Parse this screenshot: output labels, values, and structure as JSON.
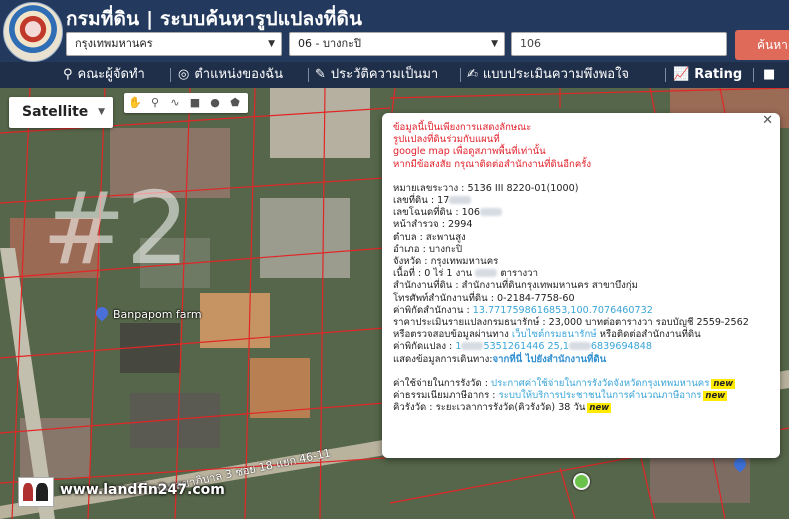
{
  "header": {
    "title": "กรมที่ดิน | ระบบค้นหารูปแปลงที่ดิน",
    "province_select": "กรุงเทพมหานคร",
    "district_select": "06 - บางกะปิ",
    "parcel_input": "106",
    "search_label": "ค้นหา"
  },
  "nav": {
    "items": [
      {
        "label": "คณะผู้จัดทำ"
      },
      {
        "label": "ตำแหน่งของฉัน"
      },
      {
        "label": "ประวัติความเป็นมา"
      },
      {
        "label": "แบบประเมินความพึงพอใจ"
      },
      {
        "label": "Rating"
      }
    ]
  },
  "map": {
    "type_select": "Satellite",
    "watermark": "#2",
    "poi_label": "Banpapom farm",
    "street_label": "ถนนสุขาภิบาล 3 ซอย 18 แยก 46-11",
    "footer_text": "www.landfin247.com"
  },
  "popup": {
    "warning": [
      "ข้อมูลนี้เป็นเพียงการแสดงลักษณะ",
      "รูปแปลงที่ดินร่วมกับแผนที่",
      "google map เพื่อดูสภาพพื้นที่เท่านั้น",
      "หากมีข้อสงสัย กรุณาติดต่อสำนักงานที่ดินอีกครั้ง"
    ],
    "map_sheet": "หมายเลขระวาง : 5136 III 8220-01(1000)",
    "land_no": "เลขที่ดิน : 17",
    "deed_no": "เลขโฉนดที่ดิน : 106",
    "survey_page": "หน้าสำรวจ : 2994",
    "subdistrict": "ตำบล : สะพานสูง",
    "district": "อำเภอ : บางกะปิ",
    "province": "จังหวัด : กรุงเทพมหานคร",
    "area_prefix": "เนื้อที่ : 0 ไร่ 1 งาน",
    "area_suffix": "ตารางวา",
    "office": "สำนักงานที่ดิน : สำนักงานที่ดินกรุงเทพมหานคร สาขาบึงกุ่ม",
    "office_phone": "โทรศัพท์สำนักงานที่ดิน : 0-2184-7758-60",
    "office_coord_label": "ค่าพิกัดสำนักงาน :",
    "office_coord_value": "13.7717598616853,100.7076460732",
    "price_line": "ราคาประเมินรายแปลงกรมธนารักษ์ : 23,000 บาทต่อตารางวา รอบบัญชี 2559-2562",
    "check_prefix": "หรือตรวจสอบข้อมูลผ่านทาง",
    "check_link": "เว็บไซต์กรมธนารักษ์",
    "check_suffix": "หรือติดต่อสำนักงานที่ดิน",
    "parcel_coord_label": "ค่าพิกัดแปลง :",
    "parcel_coord_a": "1",
    "parcel_coord_b": "5351261446 25,1",
    "parcel_coord_c": "6839694848",
    "route_prefix": "แสดงข้อมูลการเดินทาง:",
    "route_link": "จากที่นี่ ไปยังสำนักงานที่ดิน",
    "fee_label": "ค่าใช้จ่ายในการรังวัด :",
    "fee_link": "ประกาศค่าใช้จ่ายในการรังวัดจังหวัดกรุงเทพมหานคร",
    "tax_label": "ค่าธรรมเนียมภาษีอากร :",
    "tax_link": "ระบบให้บริการประชาชนในการคำนวณภาษีอากร",
    "queue_line": "คิวรังวัด : ระยะเวลาการรังวัด(คิวรังวัด) 38 วัน",
    "new_badge": "new"
  }
}
